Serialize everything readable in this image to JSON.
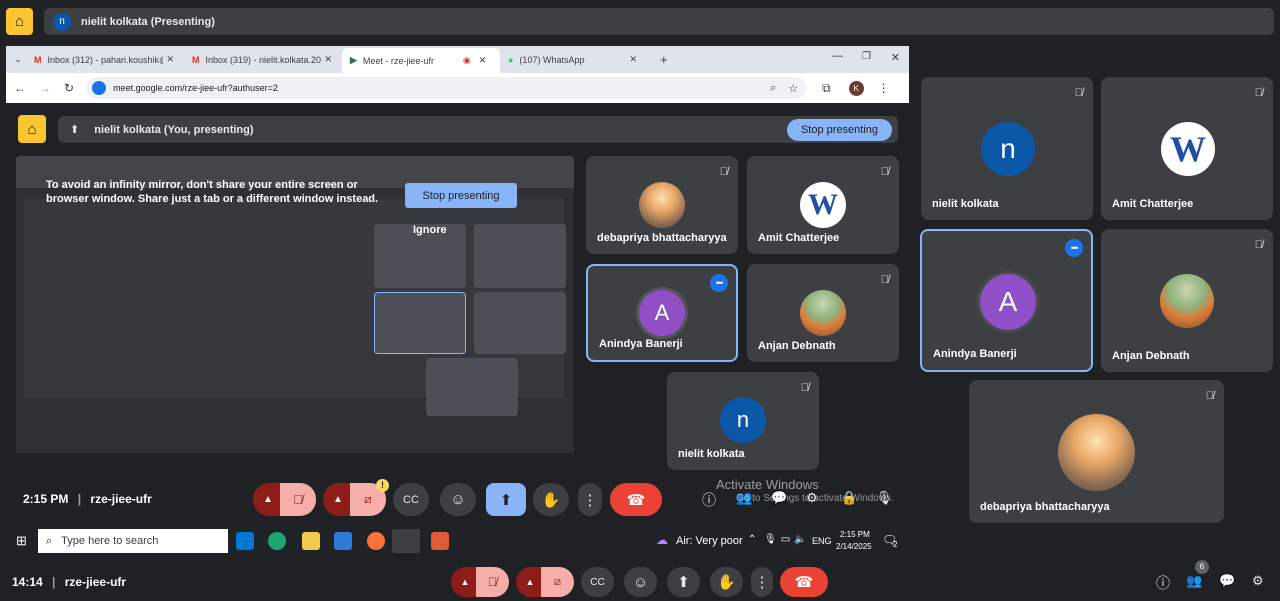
{
  "top_banner": {
    "avatar_letter": "n",
    "text": "nielit kolkata (Presenting)"
  },
  "browser": {
    "tabs": [
      {
        "label": "Inbox (312) - pahari.koushik@g"
      },
      {
        "label": "Inbox (319) - nielit.kolkata.2020"
      },
      {
        "label": "Meet - rze-jiee-ufr"
      },
      {
        "label": "(107) WhatsApp"
      }
    ],
    "url": "meet.google.com/rze-jiee-ufr?authuser=2",
    "profile_letter": "K"
  },
  "inner_meet": {
    "presenting_text": "nielit kolkata (You, presenting)",
    "stop_presenting_label": "Stop presenting",
    "mirror_warning": "To avoid an infinity mirror, don't share your entire screen or browser window. Share just a tab or a different window instead.",
    "mirror_stop_label": "Stop presenting",
    "mirror_ignore_label": "Ignore",
    "time": "2:15 PM",
    "meeting_code": "rze-jiee-ufr",
    "activate_title": "Activate Windows",
    "activate_sub": "Go to Settings to activate Windows.",
    "participants": [
      {
        "name": "debapriya bhattacharyya",
        "kind": "photo-sunset"
      },
      {
        "name": "Amit Chatterjee",
        "kind": "wlogo",
        "letter": "W"
      },
      {
        "name": "Anindya Banerji",
        "kind": "letter",
        "letter": "A",
        "color": "#8e4fc7"
      },
      {
        "name": "Anjan Debnath",
        "kind": "photo-orange"
      },
      {
        "name": "nielit kolkata",
        "kind": "letter",
        "letter": "n",
        "color": "#0b57a8"
      }
    ]
  },
  "taskbar": {
    "search_placeholder": "Type here to search",
    "weather": "Air: Very poor",
    "lang": "ENG",
    "time": "2:15 PM",
    "date": "2/14/2025",
    "notif_count": "2"
  },
  "right_panel": {
    "participants": [
      {
        "name": "nielit kolkata",
        "kind": "letter",
        "letter": "n",
        "color": "#0b57a8"
      },
      {
        "name": "Amit Chatterjee",
        "kind": "wlogo",
        "letter": "W"
      },
      {
        "name": "Anindya Banerji",
        "kind": "letter",
        "letter": "A",
        "color": "#8e4fc7"
      },
      {
        "name": "Anjan Debnath",
        "kind": "photo-orange"
      },
      {
        "name": "debapriya bhattacharyya",
        "kind": "photo-sunset"
      }
    ]
  },
  "bottom": {
    "time": "14:14",
    "meeting_code": "rze-jiee-ufr",
    "people_count": "6"
  },
  "colors": {
    "accent": "#8ab4f8",
    "end_call": "#ea4335",
    "muted": "#f6aea9",
    "logo": "#f9c531"
  }
}
